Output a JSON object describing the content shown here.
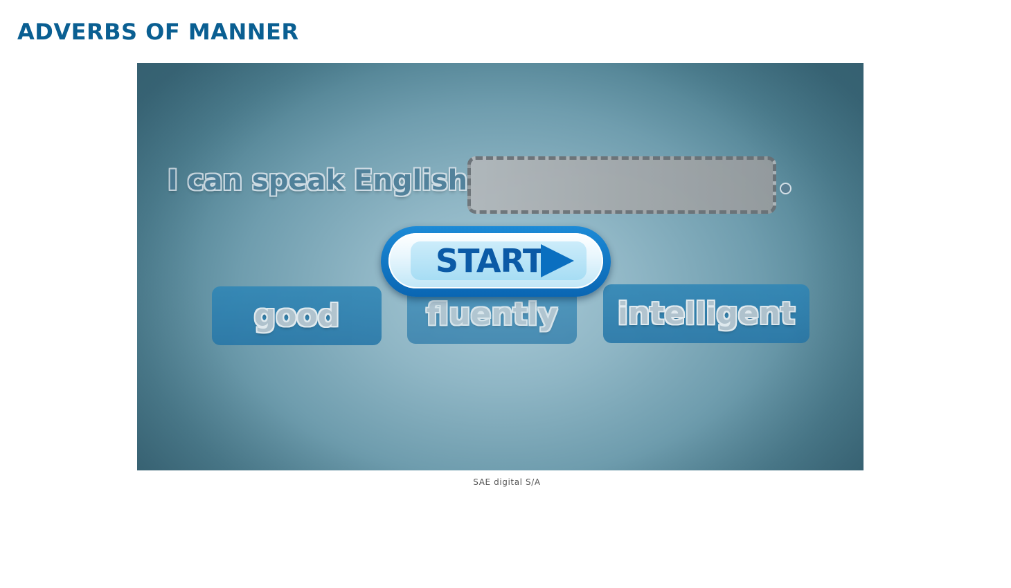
{
  "page": {
    "title": "ADVERBS OF MANNER",
    "credit": "SAE digital S/A"
  },
  "activity": {
    "sentence": "I can speak English",
    "period": ".",
    "start_label": "START",
    "options": [
      {
        "label": "good"
      },
      {
        "label": "fluently"
      },
      {
        "label": "intelligent"
      }
    ]
  },
  "colors": {
    "title": "#0a5f92",
    "start_button": "#0a66b3",
    "option_tile": "#2777a8",
    "answer_slot": "#a6a9ab"
  },
  "icons": {
    "start": "play-icon"
  }
}
